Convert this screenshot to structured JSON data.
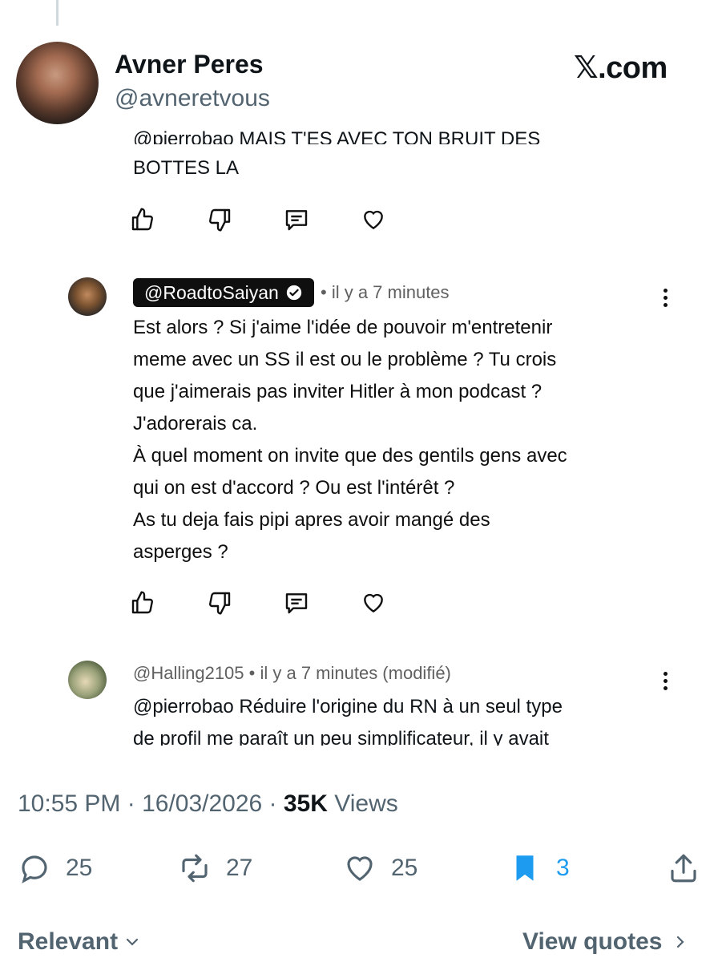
{
  "tweet": {
    "author_name": "Avner Peres",
    "author_handle": "@avneretvous",
    "site_label": "𝕏.com",
    "timestamp": "10:55 PM · 16/03/2026 · ",
    "views_count": "35K",
    "views_label": " Views"
  },
  "screenshot": {
    "cut_line": "@pierrobao MAIS T'ES AVEC TON BRUIT DES",
    "cut_line_end": "BOTTES LA",
    "comments": [
      {
        "handle": "@RoadtoSaiyan",
        "meta": "• il y a 7 minutes",
        "lines": [
          "Est alors ? Si j'aime l'idée de pouvoir m'entretenir",
          "meme avec un SS il est ou le problème ? Tu crois",
          "que j'aimerais pas inviter Hitler à mon podcast ?",
          "J'adorerais ca.",
          "À quel moment on invite que des gentils gens avec",
          "qui on est d'accord ? Ou est l'intérêt ?",
          "As tu deja fais pipi apres avoir mangé des",
          "asperges ?"
        ]
      },
      {
        "handle": "@Halling2105",
        "meta": "• il y a 7 minutes (modifié)",
        "lines": [
          "@pierrobao Réduire l'origine du RN à un seul type",
          "de profil me paraît un peu simplificateur, il y avait"
        ]
      }
    ]
  },
  "stats": {
    "replies": "25",
    "reposts": "27",
    "likes": "25",
    "bookmarks": "3"
  },
  "colors": {
    "bookmark": "#1d9bf0",
    "muted": "#536471"
  },
  "footer": {
    "sort_label": "Relevant",
    "quotes_label": "View quotes"
  }
}
